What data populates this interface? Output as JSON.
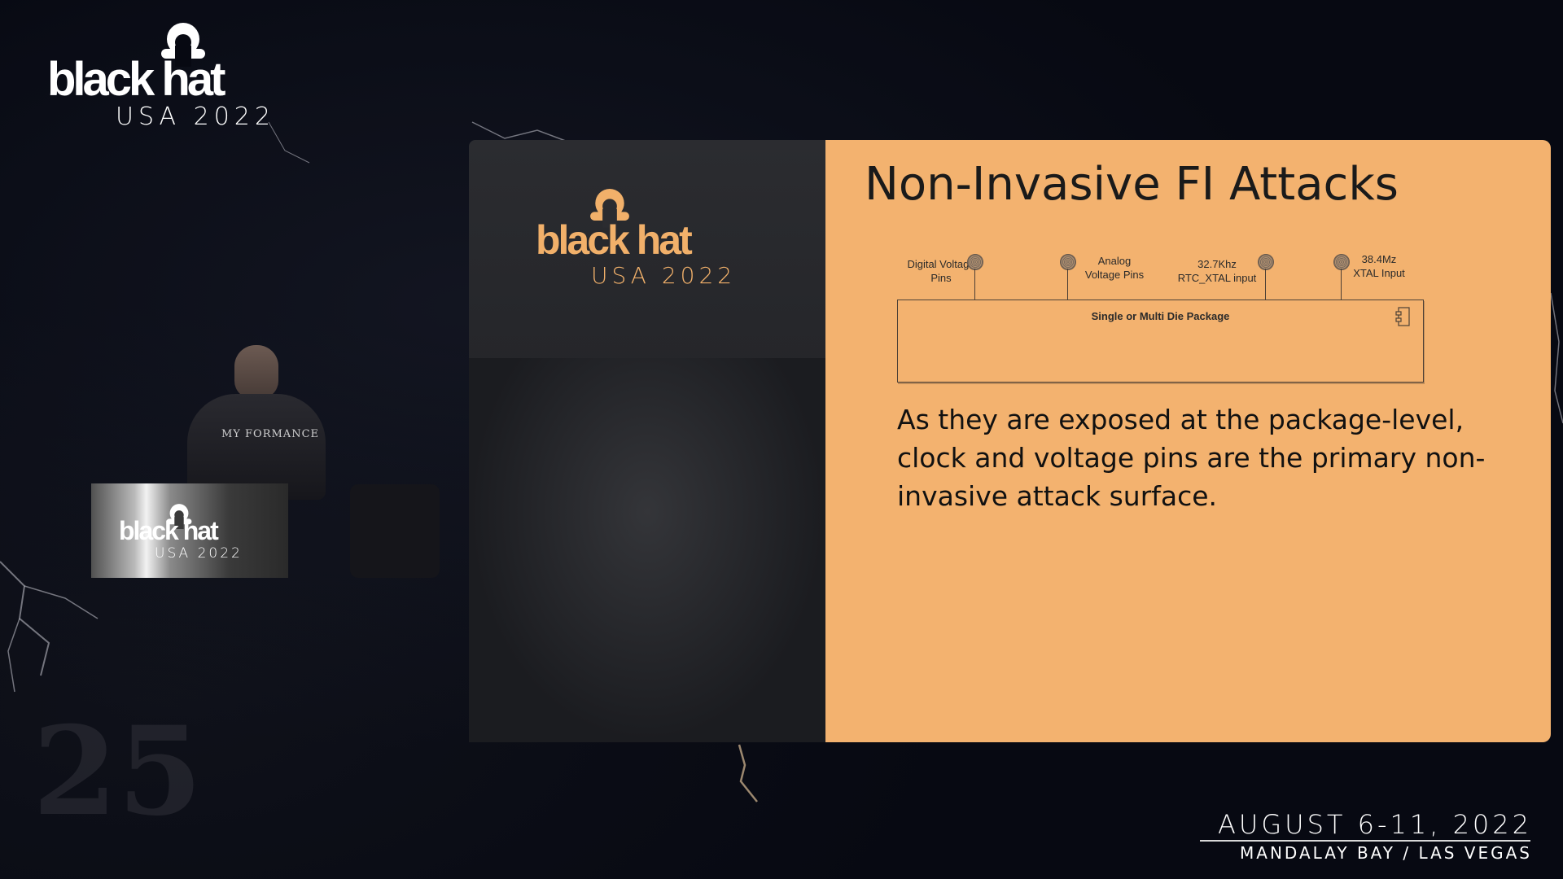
{
  "conference": {
    "brand": "black hat",
    "edition": "USA 2022",
    "date": "AUGUST 6-11, 2022",
    "venue": "MANDALAY BAY / LAS VEGAS"
  },
  "podium": {
    "brand": "black hat",
    "edition": "USA 2022"
  },
  "speaker": {
    "shirt_text": "MY FORMANCE"
  },
  "slide": {
    "side_brand": "black hat",
    "side_edition": "USA 2022",
    "title": "Non-Invasive FI Attacks",
    "pins": [
      {
        "label_line1": "Digital Voltage",
        "label_line2": "Pins"
      },
      {
        "label_line1": "Analog",
        "label_line2": "Voltage Pins"
      },
      {
        "label_line1": "32.7Khz",
        "label_line2": "RTC_XTAL input"
      },
      {
        "label_line1": "38.4Mz",
        "label_line2": "XTAL Input"
      }
    ],
    "package_label": "Single or Multi Die Package",
    "body_text": "As they are exposed at the package-level, clock and voltage pins are the primary non-invasive attack surface."
  },
  "colors": {
    "slide_accent": "#f3b26f",
    "brand_orange": "#f1b06a",
    "background": "#070912"
  },
  "icons": [
    "hat-logo-icon",
    "component-icon",
    "pin-dot-icon"
  ]
}
